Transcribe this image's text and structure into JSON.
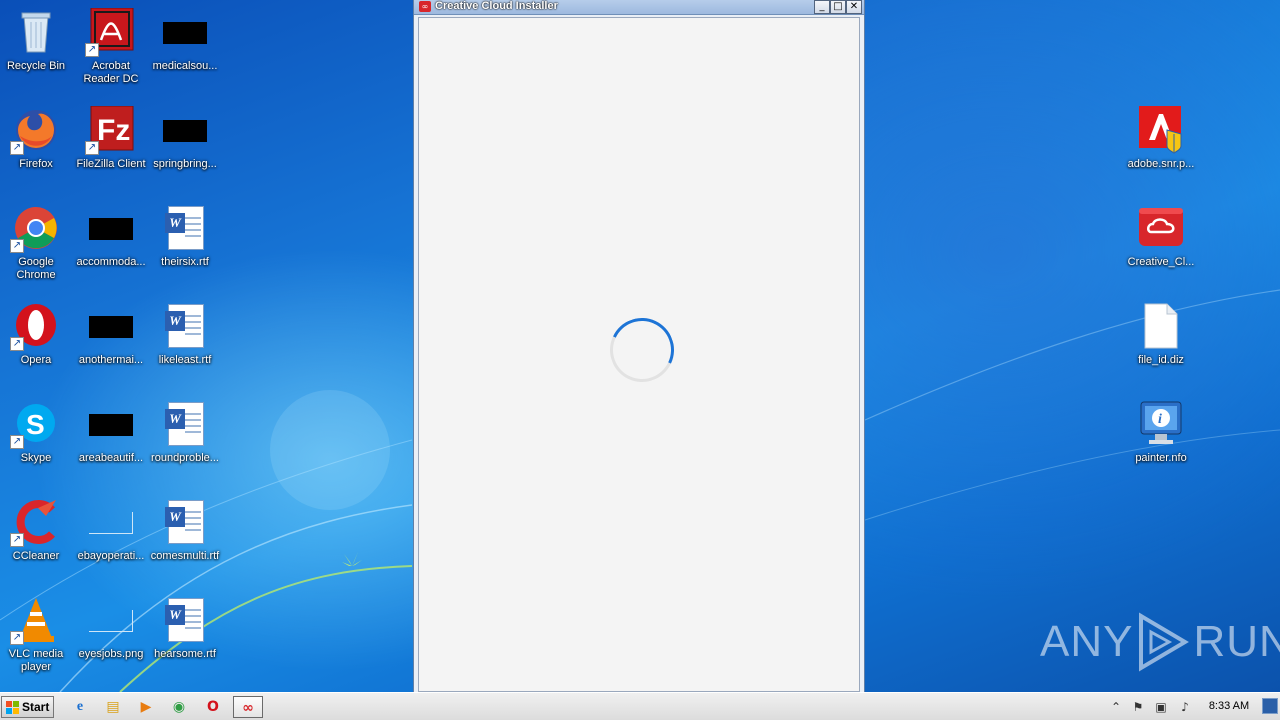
{
  "desktop": {
    "left_icons": [
      {
        "label": "Recycle Bin",
        "icon": "recycle-bin-icon"
      },
      {
        "label": "Acrobat Reader DC",
        "icon": "acrobat-icon"
      },
      {
        "label": "medicalsou...",
        "icon": "black-thumbnail-icon"
      },
      {
        "label": "Firefox",
        "icon": "firefox-icon"
      },
      {
        "label": "FileZilla Client",
        "icon": "filezilla-icon"
      },
      {
        "label": "springbring...",
        "icon": "black-thumbnail-icon"
      },
      {
        "label": "Google Chrome",
        "icon": "chrome-icon"
      },
      {
        "label": "accommoda...",
        "icon": "black-thumbnail-icon"
      },
      {
        "label": "theirsix.rtf",
        "icon": "word-document-icon"
      },
      {
        "label": "Opera",
        "icon": "opera-icon"
      },
      {
        "label": "anothermai...",
        "icon": "black-thumbnail-icon"
      },
      {
        "label": "likeleast.rtf",
        "icon": "word-document-icon"
      },
      {
        "label": "Skype",
        "icon": "skype-icon"
      },
      {
        "label": "areabeautif...",
        "icon": "black-thumbnail-icon"
      },
      {
        "label": "roundproble...",
        "icon": "word-document-icon"
      },
      {
        "label": "CCleaner",
        "icon": "ccleaner-icon"
      },
      {
        "label": "ebayoperati...",
        "icon": "blank-thumbnail-icon"
      },
      {
        "label": "comesmulti.rtf",
        "icon": "word-document-icon"
      },
      {
        "label": "VLC media player",
        "icon": "vlc-icon"
      },
      {
        "label": "eyesjobs.png",
        "icon": "blank-thumbnail-icon"
      },
      {
        "label": "hearsome.rtf",
        "icon": "word-document-icon"
      }
    ],
    "right_icons": [
      {
        "label": "adobe.snr.p...",
        "icon": "adobe-installer-icon"
      },
      {
        "label": "Creative_Cl...",
        "icon": "creative-cloud-icon"
      },
      {
        "label": "file_id.diz",
        "icon": "blank-file-icon"
      },
      {
        "label": "painter.nfo",
        "icon": "system-info-icon"
      }
    ]
  },
  "window": {
    "title": "Creative Cloud Installer",
    "minimize_glyph": "_",
    "maximize_glyph": "□",
    "close_glyph": "✕",
    "state": "loading",
    "spinner_color": "#1d74d6"
  },
  "watermark": {
    "left": "ANY",
    "right": "RUN"
  },
  "taskbar": {
    "start_label": "Start",
    "pinned": [
      {
        "name": "internet-explorer-icon",
        "glyph": "e"
      },
      {
        "name": "windows-explorer-icon",
        "glyph": "▤"
      },
      {
        "name": "media-player-icon",
        "glyph": "▶"
      },
      {
        "name": "chrome-taskbar-icon",
        "glyph": "◉"
      },
      {
        "name": "opera-taskbar-icon",
        "glyph": "O"
      },
      {
        "name": "creative-cloud-taskbar-icon",
        "glyph": "∞"
      }
    ],
    "tray": {
      "expand_glyph": "⌃",
      "clock": "8:33 AM"
    }
  },
  "colors": {
    "desktop_blue": "#1673d4",
    "adobe_red": "#d8262b",
    "taskbar_bg": "#e4e4e4"
  }
}
